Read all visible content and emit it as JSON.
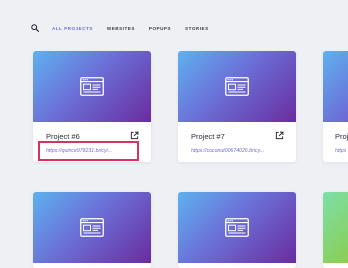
{
  "filters": {
    "tabs": [
      {
        "label": "ALL PROJECTS",
        "active": true
      },
      {
        "label": "WEBSITES",
        "active": false
      },
      {
        "label": "POPUPS",
        "active": false
      },
      {
        "label": "STORIES",
        "active": false
      }
    ]
  },
  "projects": [
    {
      "title": "Project #6",
      "url": "https://quince978231.bricyi..."
    },
    {
      "title": "Project #7",
      "url": "https://coconut00674026.bricy..."
    },
    {
      "title": "Proj",
      "url": "https"
    }
  ],
  "colors": {
    "accent": "#6b72c9",
    "highlight": "#d6345a",
    "background": "#eef0f4"
  },
  "icons": {
    "search": "search-icon",
    "thumbnail": "browser-window-icon",
    "open": "external-link-icon"
  }
}
